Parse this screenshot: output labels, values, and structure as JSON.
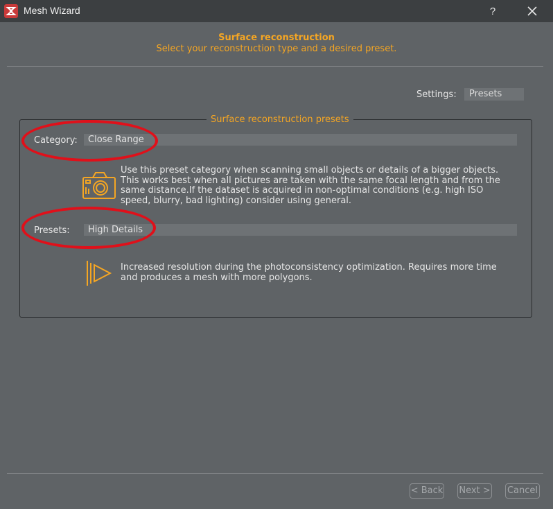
{
  "window": {
    "title": "Mesh Wizard",
    "help_label": "?",
    "app_icon": "app-logo-icon",
    "close_icon": "close-icon"
  },
  "header": {
    "title": "Surface reconstruction",
    "subtitle": "Select your reconstruction type and a desired preset."
  },
  "settings": {
    "label": "Settings:",
    "value": "Presets"
  },
  "group": {
    "title": "Surface reconstruction presets",
    "category_label": "Category:",
    "category_value": "Close Range",
    "category_icon": "camera-icon",
    "category_description": "Use this preset category when scanning small objects or details of a bigger objects. This works best when all pictures are taken with the same focal length and from the same distance.If the dataset is acquired in non-optimal conditions (e.g. high ISO speed, blurry, bad lighting) consider using general.",
    "presets_label": "Presets:",
    "presets_value": "High Details",
    "presets_icon": "triple-play-icon",
    "presets_description": "Increased resolution during the photoconsistency optimization. Requires more time and produces a mesh with more polygons."
  },
  "footer": {
    "back": "< Back",
    "next": "Next >",
    "cancel": "Cancel"
  },
  "colors": {
    "accent": "#f5a623",
    "background": "#5f6366",
    "annotation": "#e0101a"
  }
}
